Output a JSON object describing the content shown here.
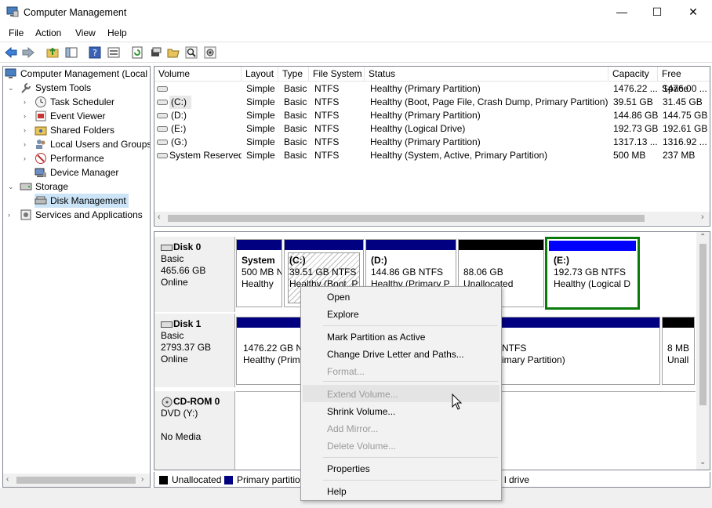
{
  "window": {
    "title": "Computer Management",
    "minimize": "—",
    "maximize": "☐",
    "close": "✕"
  },
  "menu": [
    "File",
    "Action",
    "View",
    "Help"
  ],
  "tree": {
    "root": "Computer Management (Local",
    "system_tools": "System Tools",
    "task_scheduler": "Task Scheduler",
    "event_viewer": "Event Viewer",
    "shared_folders": "Shared Folders",
    "local_users": "Local Users and Groups",
    "performance": "Performance",
    "device_manager": "Device Manager",
    "storage": "Storage",
    "disk_management": "Disk Management",
    "services": "Services and Applications"
  },
  "columns": [
    "Volume",
    "Layout",
    "Type",
    "File System",
    "Status",
    "Capacity",
    "Free Space"
  ],
  "volumes": [
    {
      "volume": "",
      "layout": "Simple",
      "type": "Basic",
      "fs": "NTFS",
      "status": "Healthy (Primary Partition)",
      "capacity": "1476.22 ...",
      "free": "1476.00 ..."
    },
    {
      "volume": "(C:)",
      "layout": "Simple",
      "type": "Basic",
      "fs": "NTFS",
      "status": "Healthy (Boot, Page File, Crash Dump, Primary Partition)",
      "capacity": "39.51 GB",
      "free": "31.45 GB"
    },
    {
      "volume": "(D:)",
      "layout": "Simple",
      "type": "Basic",
      "fs": "NTFS",
      "status": "Healthy (Primary Partition)",
      "capacity": "144.86 GB",
      "free": "144.75 GB"
    },
    {
      "volume": "(E:)",
      "layout": "Simple",
      "type": "Basic",
      "fs": "NTFS",
      "status": "Healthy (Logical Drive)",
      "capacity": "192.73 GB",
      "free": "192.61 GB"
    },
    {
      "volume": "(G:)",
      "layout": "Simple",
      "type": "Basic",
      "fs": "NTFS",
      "status": "Healthy (Primary Partition)",
      "capacity": "1317.13 ...",
      "free": "1316.92 ..."
    },
    {
      "volume": "System Reserved",
      "layout": "Simple",
      "type": "Basic",
      "fs": "NTFS",
      "status": "Healthy (System, Active, Primary Partition)",
      "capacity": "500 MB",
      "free": "237 MB"
    }
  ],
  "disks": {
    "disk0": {
      "name": "Disk 0",
      "type": "Basic",
      "size": "465.66 GB",
      "state": "Online"
    },
    "disk1": {
      "name": "Disk 1",
      "type": "Basic",
      "size": "2793.37 GB",
      "state": "Online"
    },
    "cdrom0": {
      "name": "CD-ROM 0",
      "type": "DVD (Y:)",
      "state": "No Media"
    }
  },
  "partitions": {
    "sysres": {
      "name": "System",
      "line1": "500 MB N",
      "line2": "Healthy"
    },
    "c": {
      "name": "(C:)",
      "line1": "39.51 GB NTFS",
      "line2": "Healthy (Boot, P"
    },
    "d": {
      "name": "(D:)",
      "line1": "144.86 GB NTFS",
      "line2": "Healthy (Primary P"
    },
    "unalloc0": {
      "line1": "88.06 GB",
      "line2": "Unallocated"
    },
    "e": {
      "name": "(E:)",
      "line1": "192.73 GB NTFS",
      "line2": "Healthy (Logical D"
    },
    "d1p1": {
      "line1": "1476.22 GB NT",
      "line2": "Healthy (Prim"
    },
    "d1p2": {
      "line1": "NTFS",
      "line2": "imary Partition)"
    },
    "d1u": {
      "line1": "8 MB",
      "line2": "Unall"
    }
  },
  "legend": {
    "unallocated": "Unallocated",
    "primary": "Primary partitio",
    "logical": "l drive"
  },
  "context_menu": {
    "open": "Open",
    "explore": "Explore",
    "mark_active": "Mark Partition as Active",
    "change_letter": "Change Drive Letter and Paths...",
    "format": "Format...",
    "extend": "Extend Volume...",
    "shrink": "Shrink Volume...",
    "add_mirror": "Add Mirror...",
    "delete": "Delete Volume...",
    "properties": "Properties",
    "help": "Help"
  },
  "colors": {
    "primary": "#000080",
    "logical": "#0000ff",
    "unallocated": "#000000",
    "selection": "#008000"
  }
}
